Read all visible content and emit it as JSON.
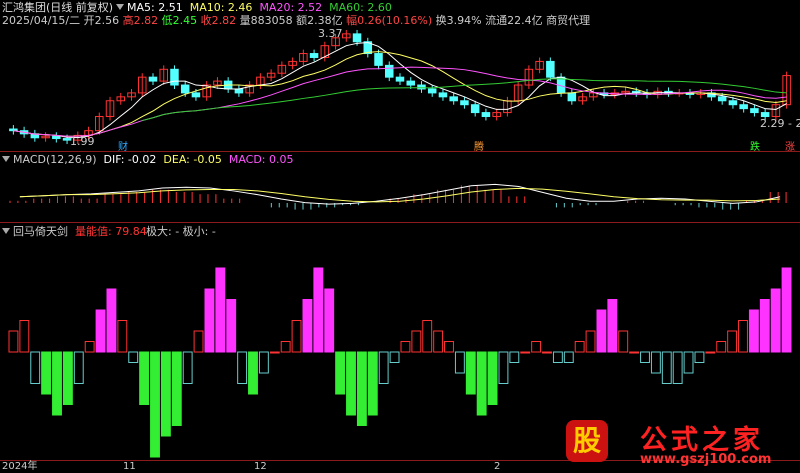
{
  "header": {
    "stock": "汇鸿集团(日线 前复权)",
    "ma5": "MA5: 2.51",
    "ma10": "MA10: 2.46",
    "ma20": "MA20: 2.52",
    "ma60": "MA60: 2.60",
    "date": "2025/04/15/二",
    "open": "开2.56",
    "high": "高2.82",
    "low": "低2.45",
    "close": "收2.82",
    "volume": "量883058",
    "amount": "额2.38亿",
    "change": "幅0.26(10.16%)",
    "turnover": "换3.94%",
    "float": "流通22.4亿",
    "industry": "商贸代理"
  },
  "labels": {
    "price_high": "3.37",
    "price_low": "1.99",
    "price_right": "2.29 - 2",
    "tag_cai": "财",
    "tag_jing": "腾",
    "tag_die": "跌",
    "tag_zhang": "涨"
  },
  "macd_panel": {
    "title": "MACD(12,26,9)",
    "dif": "DIF: -0.02",
    "dea": "DEA: -0.05",
    "macd": "MACD: 0.05"
  },
  "ind_panel": {
    "title": "回马倚天剑",
    "value": "量能值: 79.84",
    "extra": "极大: -  极小: -"
  },
  "xaxis": {
    "ticks": [
      "2024年",
      "11",
      "12",
      "2"
    ]
  },
  "watermark": {
    "icon": "股",
    "name": "公式之家",
    "url": "www.gszj100.com"
  },
  "colors": {
    "up": "#ff3333",
    "down": "#54ffff",
    "ma5": "#ffffff",
    "ma10": "#ffff66",
    "ma20": "#ff55ff",
    "ma60": "#33cc33",
    "magenta": "#ff33ff",
    "green": "#33ee33",
    "cyan": "#66cccc"
  },
  "chart_data": [
    {
      "type": "candlestick",
      "title": "汇鸿集团(日线 前复权)",
      "series_names": [
        "MA5",
        "MA10",
        "MA20",
        "MA60"
      ],
      "annotations": [
        {
          "label": "3.37",
          "type": "high"
        },
        {
          "label": "1.99",
          "type": "low"
        }
      ],
      "close_approx": [
        2.12,
        2.08,
        2.03,
        2.05,
        2.02,
        2.0,
        2.06,
        2.12,
        2.3,
        2.5,
        2.55,
        2.6,
        2.8,
        2.75,
        2.9,
        2.7,
        2.6,
        2.55,
        2.7,
        2.75,
        2.65,
        2.6,
        2.7,
        2.8,
        2.85,
        2.95,
        3.0,
        3.1,
        3.05,
        3.2,
        3.3,
        3.35,
        3.25,
        3.1,
        2.95,
        2.8,
        2.75,
        2.7,
        2.65,
        2.6,
        2.55,
        2.5,
        2.45,
        2.35,
        2.3,
        2.35,
        2.5,
        2.7,
        2.9,
        3.0,
        2.8,
        2.6,
        2.5,
        2.55,
        2.6,
        2.58,
        2.6,
        2.62,
        2.6,
        2.58,
        2.62,
        2.6,
        2.6,
        2.58,
        2.6,
        2.55,
        2.5,
        2.45,
        2.4,
        2.35,
        2.3,
        2.45,
        2.82
      ]
    },
    {
      "type": "line",
      "title": "MACD(12,26,9)",
      "series_names": [
        "DIF",
        "DEA",
        "MACD"
      ],
      "macd_hist": [
        0.01,
        0.02,
        0.03,
        0.02,
        0.04,
        0.05,
        0.06,
        0.05,
        0.04,
        0.02,
        0.0,
        -0.02,
        -0.03,
        -0.02,
        -0.01,
        0.0,
        0.02,
        0.04,
        0.06,
        0.08,
        0.06,
        0.03,
        0.0,
        -0.02,
        -0.01,
        0.0,
        0.01,
        0.0,
        -0.01,
        -0.02,
        -0.03,
        0.01,
        0.05
      ]
    },
    {
      "type": "bar",
      "title": "回马倚天剑",
      "series_names": [
        "量能值"
      ],
      "values": [
        2,
        3,
        -3,
        -4,
        -6,
        -5,
        -3,
        1,
        4,
        6,
        3,
        -1,
        -5,
        -10,
        -8,
        -7,
        -3,
        2,
        6,
        8,
        5,
        -3,
        -4,
        -2,
        0,
        1,
        3,
        5,
        8,
        6,
        -4,
        -6,
        -7,
        -6,
        -3,
        -1,
        1,
        2,
        3,
        2,
        1,
        -2,
        -4,
        -6,
        -5,
        -3,
        -1,
        0,
        1,
        0,
        -1,
        -1,
        1,
        2,
        4,
        5,
        2,
        0,
        -1,
        -2,
        -3,
        -3,
        -2,
        -1,
        0,
        1,
        2,
        3,
        4,
        5,
        6,
        8
      ]
    }
  ]
}
